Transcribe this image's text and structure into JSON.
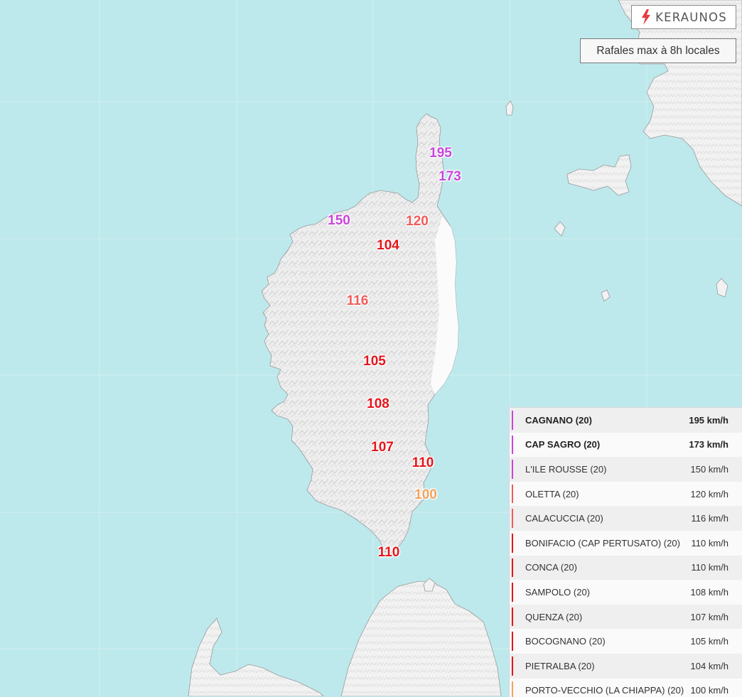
{
  "header": {
    "logo_text": "KERAUNOS",
    "title": "Rafales max à 8h locales"
  },
  "colors": {
    "sea": "#bde9ec",
    "land": "#eeeeee",
    "violet": "#c944dc",
    "salmon": "#f25a5a",
    "red": "#e5151a",
    "orange": "#f5a25d",
    "logo_accent": "#e53b3b"
  },
  "map_markers": [
    {
      "value": "195",
      "color": "#c944dc",
      "station": "CAGNANO"
    },
    {
      "value": "173",
      "color": "#c944dc",
      "station": "CAP SAGRO"
    },
    {
      "value": "150",
      "color": "#c944dc",
      "station": "L'ILE ROUSSE"
    },
    {
      "value": "120",
      "color": "#f25a5a",
      "station": "OLETTA"
    },
    {
      "value": "104",
      "color": "#e5151a",
      "station": "PIETRALBA"
    },
    {
      "value": "116",
      "color": "#f25a5a",
      "station": "CALACUCCIA"
    },
    {
      "value": "105",
      "color": "#e5151a",
      "station": "BOCOGNANO"
    },
    {
      "value": "108",
      "color": "#e5151a",
      "station": "SAMPOLO"
    },
    {
      "value": "107",
      "color": "#e5151a",
      "station": "QUENZA"
    },
    {
      "value": "110",
      "color": "#e5151a",
      "station": "CONCA"
    },
    {
      "value": "100",
      "color": "#f5a25d",
      "station": "PORTO-VECCHIO"
    },
    {
      "value": "110",
      "color": "#e5151a",
      "station": "BONIFACIO"
    }
  ],
  "legend": {
    "rows": [
      {
        "name": "CAGNANO (20)",
        "value": "195 km/h",
        "color": "#c944dc",
        "bold": true
      },
      {
        "name": "CAP SAGRO (20)",
        "value": "173 km/h",
        "color": "#c944dc",
        "bold": true
      },
      {
        "name": "L'ILE ROUSSE (20)",
        "value": "150 km/h",
        "color": "#c944dc",
        "bold": false
      },
      {
        "name": "OLETTA (20)",
        "value": "120 km/h",
        "color": "#f25a5a",
        "bold": false
      },
      {
        "name": "CALACUCCIA (20)",
        "value": "116 km/h",
        "color": "#f25a5a",
        "bold": false
      },
      {
        "name": "BONIFACIO (CAP PERTUSATO) (20)",
        "value": "110 km/h",
        "color": "#e5151a",
        "bold": false
      },
      {
        "name": "CONCA (20)",
        "value": "110 km/h",
        "color": "#e5151a",
        "bold": false
      },
      {
        "name": "SAMPOLO (20)",
        "value": "108 km/h",
        "color": "#e5151a",
        "bold": false
      },
      {
        "name": "QUENZA (20)",
        "value": "107 km/h",
        "color": "#e5151a",
        "bold": false
      },
      {
        "name": "BOCOGNANO (20)",
        "value": "105 km/h",
        "color": "#e5151a",
        "bold": false
      },
      {
        "name": "PIETRALBA (20)",
        "value": "104 km/h",
        "color": "#e5151a",
        "bold": false
      },
      {
        "name": "PORTO-VECCHIO (LA CHIAPPA) (20)",
        "value": "100 km/h",
        "color": "#f5a25d",
        "bold": false
      }
    ]
  }
}
